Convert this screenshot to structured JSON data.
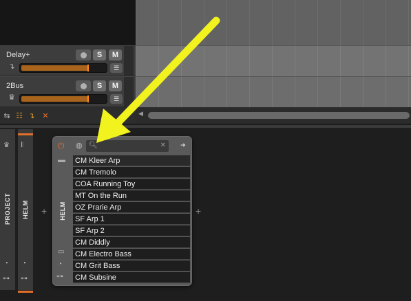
{
  "tracks": [
    {
      "name": "Delay+",
      "icon": "return-arrow-icon",
      "solo_label": "S",
      "mute_label": "M"
    },
    {
      "name": "2Bus",
      "icon": "crown-icon",
      "solo_label": "S",
      "mute_label": "M"
    }
  ],
  "track_menu_glyph": "☰",
  "toolbar": {
    "icons": [
      "swap-icon",
      "list-icon",
      "return-icon",
      "close-icon"
    ]
  },
  "device_chain": {
    "project_label": "PROJECT",
    "helm_label": "HELM",
    "device_label": "HELM",
    "plus": "+"
  },
  "browser": {
    "search_placeholder": "",
    "close_glyph": "✕",
    "forward_glyph": "➜",
    "presets": [
      "CM Kleer Arp",
      "CM Tremolo",
      "COA Running Toy",
      "MT On the Run",
      "OZ Prarie Arp",
      "SF Arp 1",
      "SF Arp 2",
      "CM Diddly",
      "CM Electro Bass",
      "CM Grit Bass",
      "CM Subsine"
    ]
  },
  "colors": {
    "accent_orange": "#e0702a",
    "annotation_arrow": "#f2f21f"
  }
}
